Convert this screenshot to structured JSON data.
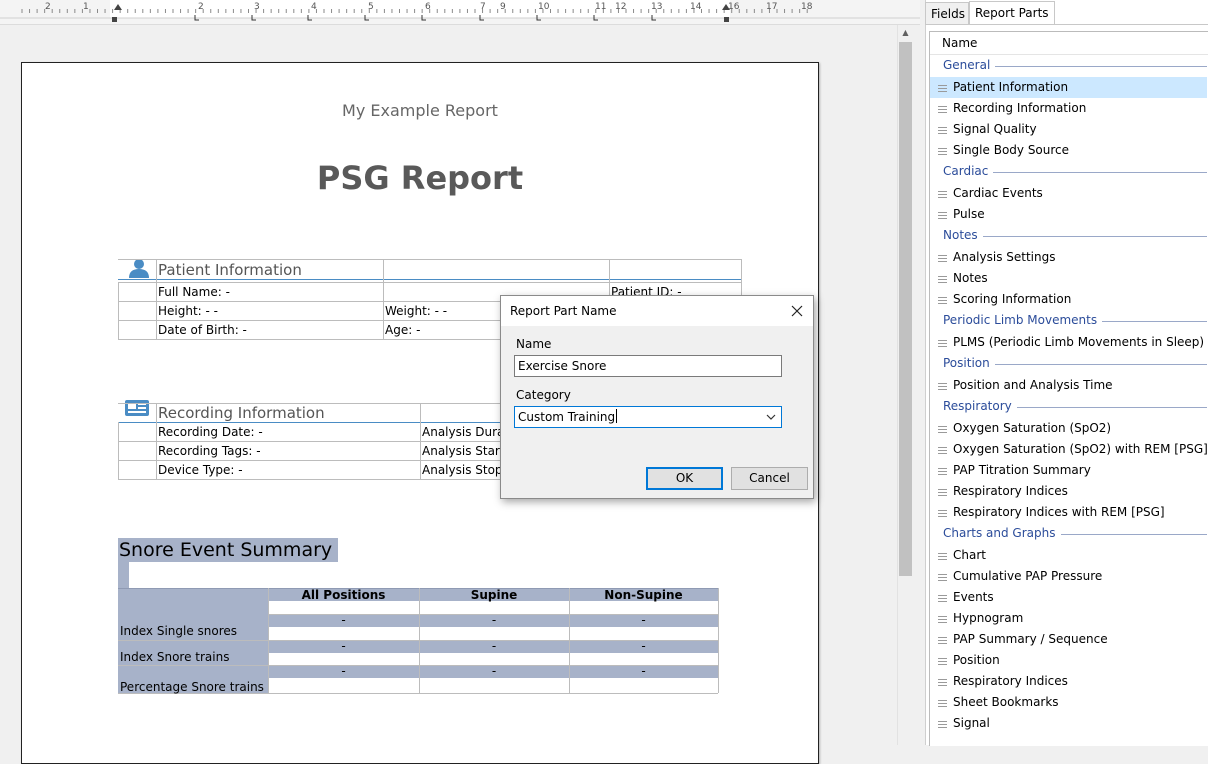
{
  "ruler": {
    "numbers": [
      "2",
      "1",
      "1",
      "2",
      "3",
      "4",
      "5",
      "6",
      "7",
      "8",
      "9",
      "10",
      "11",
      "12",
      "13",
      "14",
      "15",
      "16",
      "17",
      "18"
    ]
  },
  "report": {
    "header_text": "My Example Report",
    "title": "PSG Report",
    "patient_section": {
      "title": "Patient Information",
      "icon": "person-icon",
      "full_name": "Full Name: -",
      "height": "Height: - -",
      "weight": "Weight: - -",
      "dob": "Date of Birth: -",
      "age": "Age: -",
      "patient_id": "Patient ID: -"
    },
    "recording_section": {
      "title": "Recording Information",
      "icon": "recorder-icon",
      "date": "Recording Date: -",
      "tags": "Recording Tags: -",
      "device": "Device Type: -",
      "duration": "Analysis Durati",
      "start": "Analysis Start T",
      "stop": "Analysis Stop T"
    },
    "snore_section": {
      "title": "Snore Event Summary",
      "columns": [
        "All Positions",
        "Supine",
        "Non-Supine"
      ],
      "rows": [
        {
          "label": "Index Single snores",
          "values": [
            "-",
            "-",
            "-"
          ]
        },
        {
          "label": "Index Snore trains",
          "values": [
            "-",
            "-",
            "-"
          ]
        },
        {
          "label": "Percentage Snore trains",
          "values": [
            "-",
            "-",
            "-"
          ]
        }
      ]
    }
  },
  "dialog": {
    "title": "Report Part Name",
    "name_label": "Name",
    "name_value": "Exercise Snore",
    "category_label": "Category",
    "category_value": "Custom Training",
    "ok_label": "OK",
    "cancel_label": "Cancel"
  },
  "right_panel": {
    "tabs": [
      "Fields",
      "Report Parts"
    ],
    "active_tab": "Report Parts",
    "column_header": "Name",
    "categories": [
      {
        "name": "General",
        "items": [
          "Patient Information",
          "Recording Information",
          "Signal Quality",
          "Single Body Source"
        ]
      },
      {
        "name": "Cardiac",
        "items": [
          "Cardiac Events",
          "Pulse"
        ]
      },
      {
        "name": "Notes",
        "items": [
          "Analysis Settings",
          "Notes",
          "Scoring Information"
        ]
      },
      {
        "name": "Periodic Limb Movements",
        "items": [
          "PLMS (Periodic Limb Movements in Sleep)"
        ]
      },
      {
        "name": "Position",
        "items": [
          "Position and Analysis Time"
        ]
      },
      {
        "name": "Respiratory",
        "items": [
          "Oxygen Saturation (SpO2)",
          "Oxygen Saturation (SpO2) with REM [PSG]",
          "PAP Titration Summary",
          "Respiratory Indices",
          "Respiratory Indices with REM [PSG]"
        ]
      },
      {
        "name": "Charts and Graphs",
        "items": [
          "Chart",
          "Cumulative PAP Pressure",
          "Events",
          "Hypnogram",
          "PAP Summary / Sequence",
          "Position",
          "Respiratory Indices",
          "Sheet Bookmarks",
          "Signal"
        ]
      }
    ],
    "selected_item": "Patient Information"
  },
  "colors": {
    "accent": "#4a8cc4",
    "category_text": "#2b4c9a",
    "selection": "#cce8ff",
    "snore_band": "#a7b2c9"
  }
}
